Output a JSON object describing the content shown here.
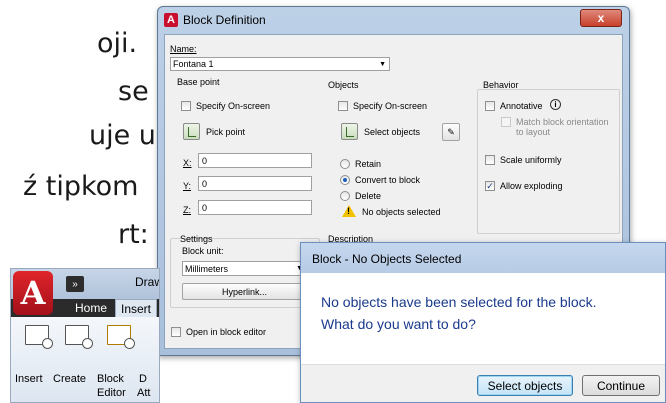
{
  "slide": {
    "lines": [
      "oji.",
      "se",
      "uje u",
      "ź tipkom",
      "rt:"
    ]
  },
  "block_definition": {
    "title": "Block Definition",
    "close_glyph": "x",
    "name_label": "Name:",
    "name_value": "Fontana 1",
    "base_point": {
      "title": "Base point",
      "specify_onscreen": "Specify On-screen",
      "pick_point": "Pick point",
      "x_label": "X:",
      "x_value": "0",
      "y_label": "Y:",
      "y_value": "0",
      "z_label": "Z:",
      "z_value": "0"
    },
    "objects": {
      "title": "Objects",
      "specify_onscreen": "Specify On-screen",
      "select_objects": "Select objects",
      "retain": "Retain",
      "convert_to_block": "Convert to block",
      "delete": "Delete",
      "status": "No objects selected"
    },
    "behavior": {
      "title": "Behavior",
      "annotative": "Annotative",
      "info_glyph": "i",
      "match_orientation": "Match block orientation to layout",
      "scale_uniformly": "Scale uniformly",
      "allow_exploding": "Allow exploding",
      "allow_exploding_checked": true
    },
    "settings": {
      "title": "Settings",
      "block_unit_label": "Block unit:",
      "block_unit_value": "Millimeters",
      "hyperlink": "Hyperlink..."
    },
    "description_title": "Description",
    "open_in_editor": "Open in block editor"
  },
  "ribbon": {
    "logo_glyph": "A",
    "more_glyph": "»",
    "title_partial": "Drawi",
    "tabs": [
      "Home",
      "Insert"
    ],
    "active_tab": "Insert",
    "tools": [
      {
        "label": "Insert"
      },
      {
        "label": "Create"
      },
      {
        "label": "Block",
        "label2": "Editor"
      },
      {
        "label": "D",
        "label2": "Att"
      }
    ]
  },
  "message_box": {
    "title": "Block - No Objects Selected",
    "line1": "No objects have been selected for the block.",
    "line2": "What do you want to do?",
    "primary_button": "Select objects",
    "secondary_button": "Continue"
  }
}
